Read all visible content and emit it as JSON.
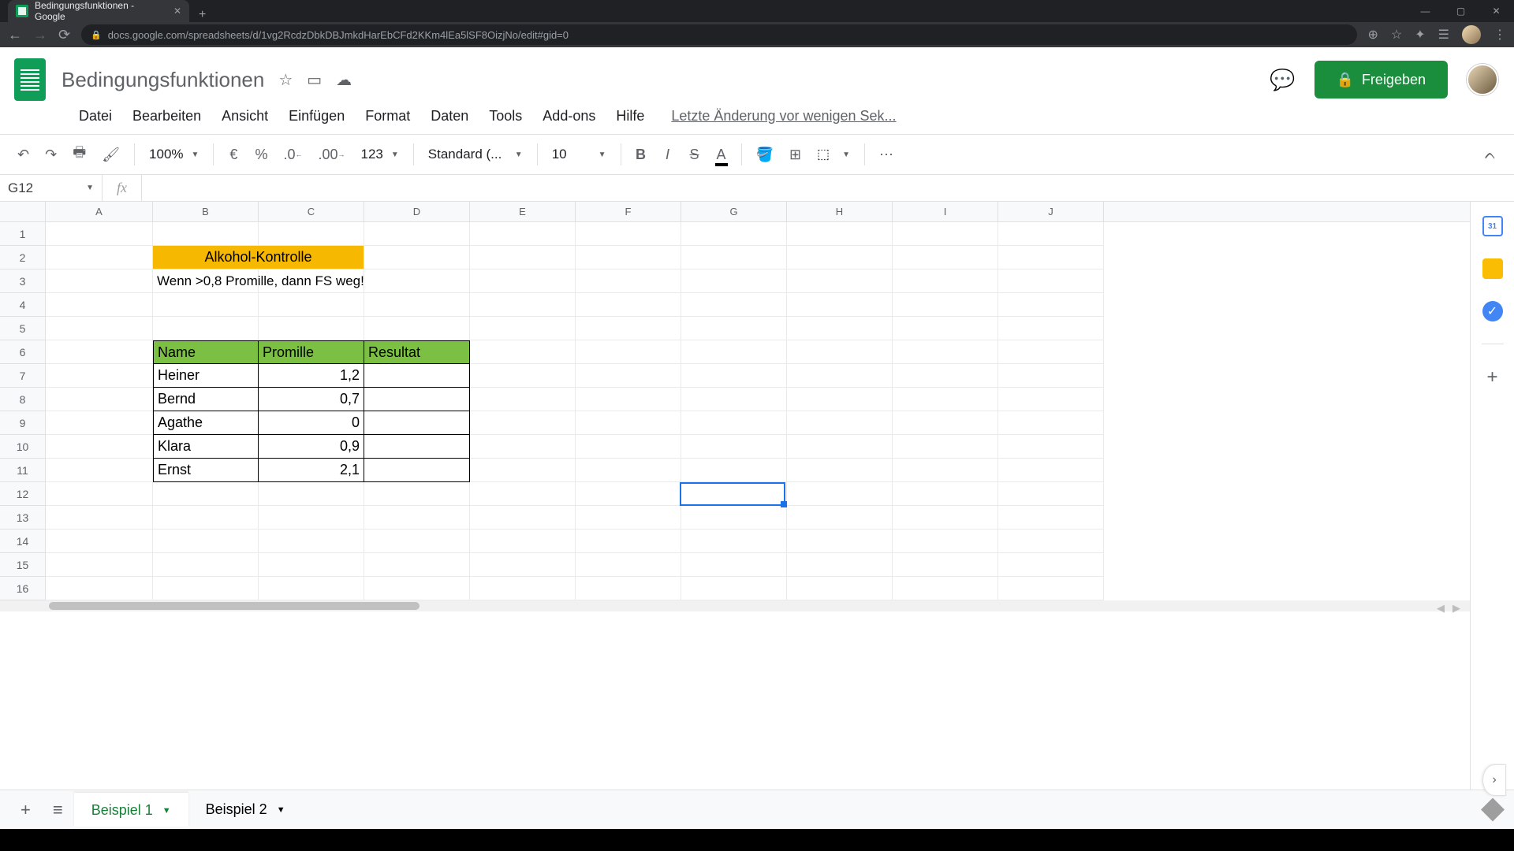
{
  "browser": {
    "tab_title": "Bedingungsfunktionen - Google",
    "url": "docs.google.com/spreadsheets/d/1vg2RcdzDbkDBJmkdHarEbCFd2KKm4lEa5lSF8OizjNo/edit#gid=0"
  },
  "doc": {
    "title": "Bedingungsfunktionen",
    "share_label": "Freigeben",
    "last_edit": "Letzte Änderung vor wenigen Sek..."
  },
  "menu": {
    "datei": "Datei",
    "bearbeiten": "Bearbeiten",
    "ansicht": "Ansicht",
    "einfuegen": "Einfügen",
    "format": "Format",
    "daten": "Daten",
    "tools": "Tools",
    "addons": "Add-ons",
    "hilfe": "Hilfe"
  },
  "toolbar": {
    "zoom": "100%",
    "currency": "€",
    "percent": "%",
    "dec_less": ".0",
    "dec_more": ".00",
    "num_fmt": "123",
    "font": "Standard (...",
    "size": "10"
  },
  "namebox": "G12",
  "columns": [
    "A",
    "B",
    "C",
    "D",
    "E",
    "F",
    "G",
    "H",
    "I",
    "J"
  ],
  "rows": [
    "1",
    "2",
    "3",
    "4",
    "5",
    "6",
    "7",
    "8",
    "9",
    "10",
    "11",
    "12",
    "13",
    "14",
    "15",
    "16"
  ],
  "cells": {
    "title_merged": "Alkohol-Kontrolle",
    "rule": "Wenn >0,8 Promille, dann FS weg!",
    "h_name": "Name",
    "h_promille": "Promille",
    "h_resultat": "Resultat",
    "r7_name": "Heiner",
    "r7_prom": "1,2",
    "r8_name": "Bernd",
    "r8_prom": "0,7",
    "r9_name": "Agathe",
    "r9_prom": "0",
    "r10_name": "Klara",
    "r10_prom": "0,9",
    "r11_name": "Ernst",
    "r11_prom": "2,1"
  },
  "sheets": {
    "s1": "Beispiel 1",
    "s2": "Beispiel 2"
  },
  "side": {
    "cal": "31"
  }
}
